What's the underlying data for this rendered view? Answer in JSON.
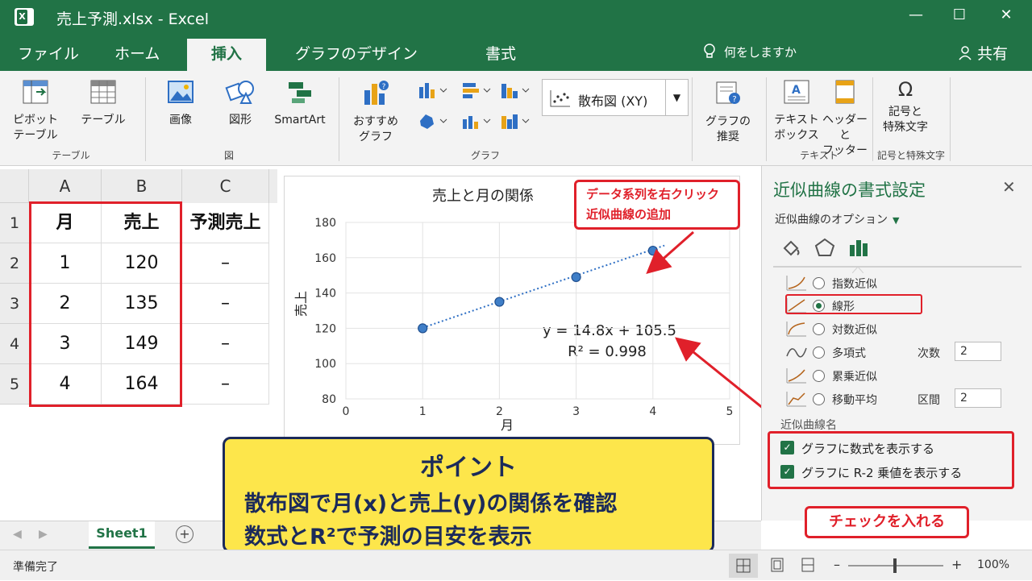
{
  "window": {
    "title": "売上予測.xlsx  -  Excel",
    "app_icon": "X"
  },
  "tabs": [
    "ファイル",
    "ホーム",
    "挿入",
    "グラフのデザイン",
    "書式"
  ],
  "tell_me": "何をしますか",
  "share": "共有",
  "ribbon": {
    "pivot": "ピボット\nテーブル",
    "table": "テーブル",
    "group_table": "テーブル",
    "image": "画像",
    "shape": "図形",
    "smartart": "SmartArt",
    "group_figure": "図",
    "recommended": "おすすめ\nグラフ",
    "chart_combo": "散布図 (XY)",
    "group_chart": "グラフ",
    "chart_recommend": "グラフの\n推奨",
    "textbox": "テキスト\nボックス",
    "header_footer": "ヘッダーと\nフッター",
    "group_text": "テキスト",
    "symbols": "記号と\n特殊文字",
    "group_symbols": "記号と特殊文字"
  },
  "sheet": {
    "columns": [
      "A",
      "B",
      "C"
    ],
    "rows": [
      "1",
      "2",
      "3",
      "4",
      "5"
    ],
    "header": [
      "月",
      "売上",
      "予測売上"
    ],
    "data": [
      [
        "1",
        "120",
        "–"
      ],
      [
        "2",
        "135",
        "–"
      ],
      [
        "3",
        "149",
        "–"
      ],
      [
        "4",
        "164",
        "–"
      ]
    ]
  },
  "chart_data": {
    "type": "scatter",
    "title": "売上と月の関係",
    "xlabel": "月",
    "ylabel": "売上",
    "xlim": [
      0,
      5
    ],
    "ylim": [
      80,
      180
    ],
    "xticks": [
      "0",
      "1",
      "2",
      "3",
      "4",
      "5"
    ],
    "yticks": [
      "80",
      "100",
      "120",
      "140",
      "160",
      "180"
    ],
    "x": [
      1,
      2,
      3,
      4
    ],
    "y": [
      120,
      135,
      149,
      164
    ],
    "trendline": {
      "type": "linear",
      "slope": 14.8,
      "intercept": 105.5
    },
    "equation": "y = 14.8x + 105.5",
    "r2": "R² = 0.998",
    "grid": true,
    "colors": {
      "points": "#3f7ec7",
      "trendline": "#2e6fc4"
    }
  },
  "callout_top": {
    "line1": "データ系列を右クリック",
    "line2": "近似曲線の追加"
  },
  "pane": {
    "title": "近似曲線の書式設定",
    "options_label": "近似曲線のオプション",
    "types": [
      "指数近似",
      "線形",
      "対数近似",
      "多項式",
      "累乗近似",
      "移動平均"
    ],
    "order_label": "次数",
    "order_value": "2",
    "period_label": "区間",
    "period_value": "2",
    "trend_name": "近似曲線名",
    "check1": "グラフに数式を表示する",
    "check2": "グラフに R-2 乗値を表示する"
  },
  "callout_check": "チェックを入れる",
  "point_box": {
    "title": "ポイント",
    "line1": "散布図で月(x)と売上(y)の関係を確認",
    "line2": "数式とR²で予測の目安を表示"
  },
  "sheet_tab": "Sheet1",
  "status": {
    "ready": "準備完了",
    "zoom": "100%"
  },
  "colors": {
    "accent": "#217346",
    "highlight": "#e0202a",
    "point_bg": "#fde64b",
    "point_border": "#1b2a5a"
  }
}
